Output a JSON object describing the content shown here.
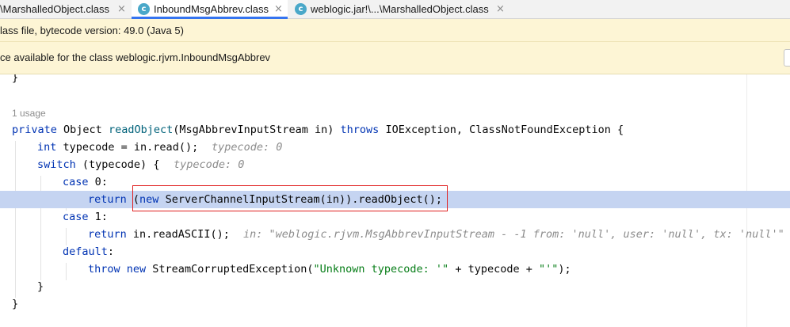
{
  "tabs": [
    {
      "label": "\\MarshalledObject.class",
      "close": "×",
      "active": false,
      "icon": "class-file-icon"
    },
    {
      "label": "InboundMsgAbbrev.class",
      "close": "×",
      "active": true,
      "icon": "class-file-icon"
    },
    {
      "label": "weblogic.jar!\\...\\MarshalledObject.class",
      "close": "×",
      "active": false,
      "icon": "class-file-icon"
    }
  ],
  "icon_glyph": "c",
  "banners": {
    "bytecode": "lass file, bytecode version: 49.0 (Java 5)",
    "source": "ce available for the class weblogic.rjvm.InboundMsgAbbrev"
  },
  "code": {
    "l0": "}",
    "usage": "1 usage",
    "l2": {
      "kw1": "private",
      "t1": " Object ",
      "m": "readObject",
      "t2": "(MsgAbbrevInputStream in) ",
      "kw2": "throws",
      "t3": " IOException, ClassNotFoundException {"
    },
    "l3": {
      "kw": "int",
      "t": " typecode = in.read();",
      "hint": "typecode: 0"
    },
    "l4": {
      "kw": "switch",
      "t": " (typecode) {",
      "hint": "typecode: 0"
    },
    "l5": {
      "kw": "case",
      "t": " 0:"
    },
    "l6": {
      "kw1": "return",
      "t1": " (",
      "kw2": "new",
      "t2": " ServerChannelInputStream(in)).readObject();"
    },
    "l7": {
      "kw": "case",
      "t": " 1:"
    },
    "l8": {
      "kw": "return",
      "t": " in.readASCII();",
      "hint": "in: \"weblogic.rjvm.MsgAbbrevInputStream - -1 from: 'null', user: 'null', tx: 'null'\""
    },
    "l9": {
      "kw": "default",
      "t": ":"
    },
    "l10": {
      "kw1": "throw",
      "t1": " ",
      "kw2": "new",
      "t2": " StreamCorruptedException(",
      "s1": "\"Unknown typecode: '\"",
      "t3": " + typecode + ",
      "s2": "\"'\"",
      "t4": ");"
    },
    "l11": "}",
    "l12": "}"
  },
  "colors": {
    "keyword": "#0033b3",
    "string": "#067d17",
    "hint": "#8c8c8c",
    "highlight": "#c5d4f1",
    "banner": "#fdf5d5",
    "active_tab_underline": "#3574f0",
    "annotation_box": "#e02020"
  }
}
